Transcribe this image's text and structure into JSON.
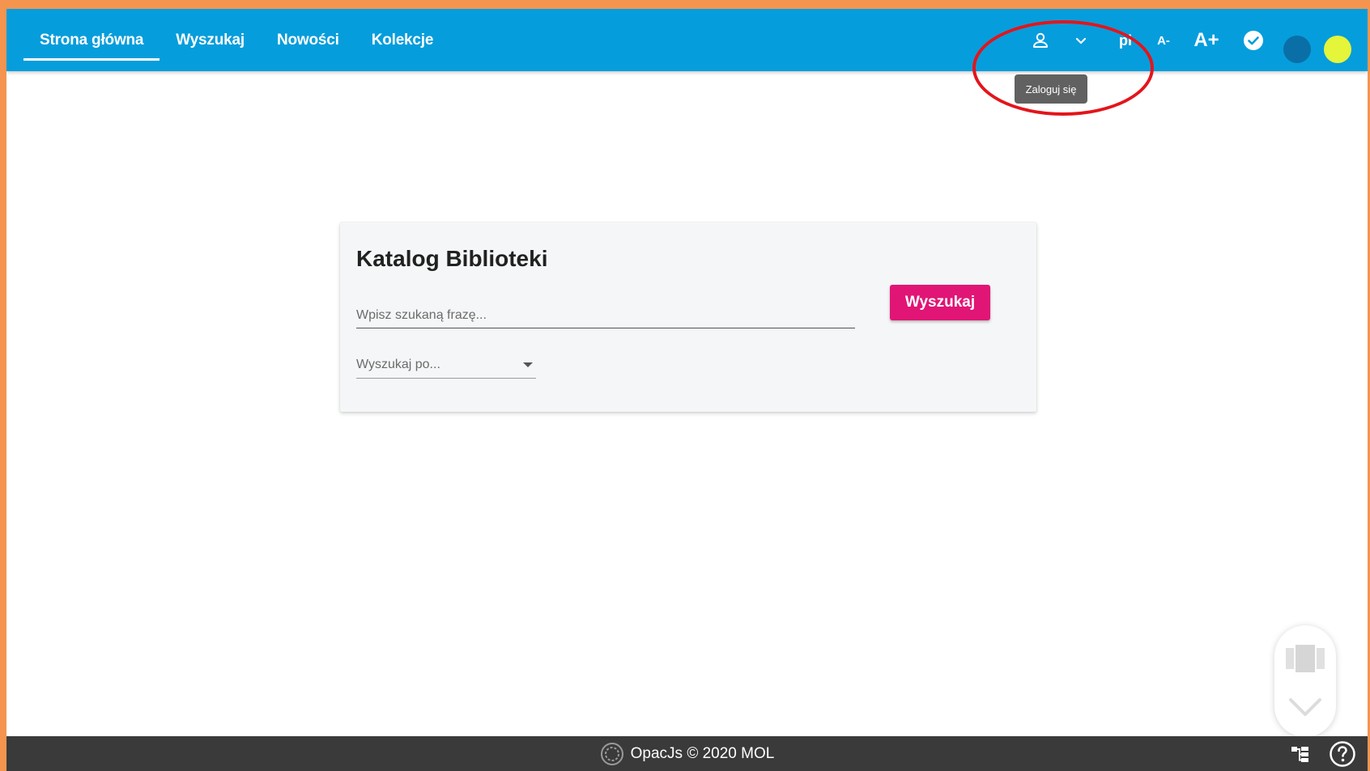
{
  "nav": {
    "items": [
      {
        "label": "Strona główna",
        "active": true
      },
      {
        "label": "Wyszukaj",
        "active": false
      },
      {
        "label": "Nowości",
        "active": false
      },
      {
        "label": "Kolekcje",
        "active": false
      }
    ]
  },
  "toolbar": {
    "user_icon": "user-icon",
    "chevron_icon": "chevron-down-icon",
    "lang_label": "pl",
    "font_smaller_label": "A-",
    "font_bigger_label": "A+",
    "check_icon": "check-circle-icon",
    "theme_dark_color": "#0a6fa6",
    "theme_lime_color": "#e4f53a",
    "tooltip": "Zaloguj się"
  },
  "colors": {
    "topbar": "#069ddc",
    "accent_button": "#e11576",
    "footer": "#3a3a3a",
    "annotation_outline": "#e3151b",
    "border_frame": "#f4944f"
  },
  "search_card": {
    "title": "Katalog Biblioteki",
    "input_placeholder": "Wpisz szukaną frazę...",
    "input_value": "",
    "search_button_label": "Wyszukaj",
    "select_label": "Wyszukaj po..."
  },
  "footer": {
    "text": "OpacJs © 2020 MOL",
    "logo_icon": "opacjs-logo-icon",
    "sitemap_icon": "sitemap-icon",
    "help_icon": "help-circle-icon"
  }
}
